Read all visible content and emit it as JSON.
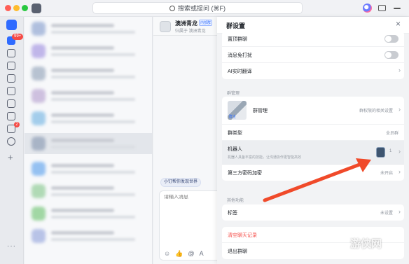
{
  "titlebar": {
    "search_label": "搜索或提问 (⌘F)",
    "icons": [
      "app-logo-icon",
      "search-icon",
      "ai-assistant-icon",
      "window-icon",
      "minimize-icon"
    ]
  },
  "rail": {
    "badge_messages": "99+",
    "badge_tasks": "2",
    "icons": [
      "messages-icon",
      "docs-icon",
      "contacts-icon",
      "calendar-icon",
      "meeting-icon",
      "video-icon",
      "help-icon",
      "tasks-icon",
      "bolt-icon",
      "add-icon",
      "more-icon"
    ]
  },
  "chat": {
    "group_name": "澳洲青龙",
    "group_tag": "内部群",
    "group_subtitle": "归属于 澳洲青龙",
    "pill_label": "小钉帮你发现世界",
    "input_placeholder": "请输入消息",
    "tools": [
      "☺",
      "👍",
      "@",
      "A"
    ]
  },
  "panel": {
    "title": "群设置",
    "close_glyph": "×",
    "top_rows": [
      {
        "label": "置顶群聊",
        "type": "toggle"
      },
      {
        "label": "消息免打扰",
        "type": "toggle"
      },
      {
        "label": "AI实时翻译",
        "type": "link"
      }
    ],
    "section_manage": "群管理",
    "manage_row": {
      "label": "群管理",
      "value": "群权限的相关设置",
      "thumb_label": "群主"
    },
    "group_type": {
      "label": "群类型",
      "value": "全员群"
    },
    "robot": {
      "label": "机器人",
      "desc": "机器人具备丰富的技能，让沟通协作更智能高效",
      "count": "1"
    },
    "third_party": {
      "label": "第三方密码加密",
      "value": "未开启"
    },
    "section_other": "其他功能",
    "tags": {
      "label": "标签",
      "value": "未设置"
    },
    "clear_history": {
      "label": "清空聊天记录"
    },
    "bottom_row": {
      "label": "退出群聊"
    }
  },
  "colors": {
    "accent": "#3370ff",
    "arrow": "#f04a2a",
    "danger": "#f54a45"
  },
  "watermark": "游侠网"
}
